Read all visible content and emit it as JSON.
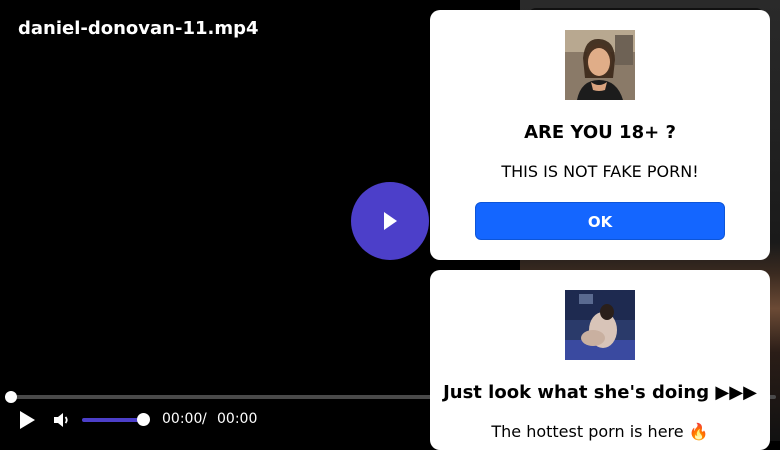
{
  "player": {
    "filename": "daniel-donovan-11.mp4",
    "current_time": "00:00",
    "time_separator": "/",
    "duration": "00:00",
    "progress": 0,
    "volume": 1.0,
    "accent_color": "#4c3fc9",
    "icons": {
      "big_play": "play-icon",
      "play": "play-icon",
      "volume": "volume-icon"
    }
  },
  "popup_age": {
    "avatar": "woman-photo",
    "heading": "ARE YOU 18+ ?",
    "text": "THIS IS NOT FAKE PORN!",
    "button_label": "OK",
    "button_color": "#1466ff"
  },
  "popup_promo": {
    "avatar": "couple-photo",
    "heading": "Just look what she's doing ▶▶▶",
    "text": "The hottest porn is here 🔥"
  }
}
